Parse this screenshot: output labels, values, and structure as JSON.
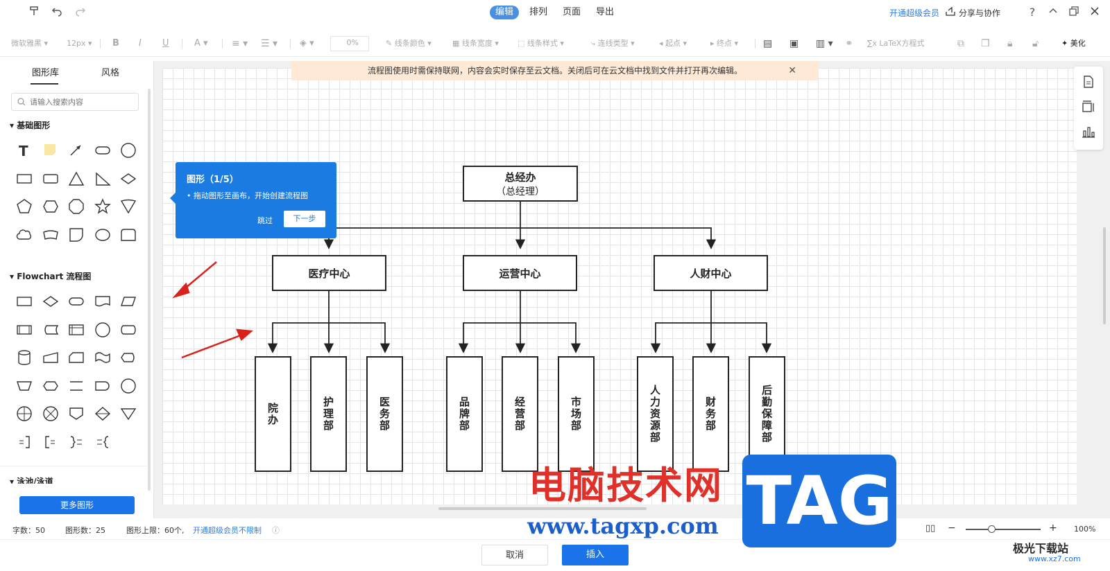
{
  "topbar": {
    "modes": [
      {
        "label": "编辑",
        "active": true
      },
      {
        "label": "排列",
        "active": false
      },
      {
        "label": "页面",
        "active": false
      },
      {
        "label": "导出",
        "active": false
      }
    ],
    "vip_link": "开通超级会员",
    "share_label": "分享与协作",
    "help": "?"
  },
  "toolbar": {
    "font": "微软雅黑",
    "size": "12px",
    "bold": "B",
    "italic": "I",
    "underline": "U",
    "font_color": "A",
    "opacity": "0%",
    "line_color": "线条颜色",
    "line_width": "线条宽度",
    "line_style": "线条样式",
    "connector_type": "连线类型",
    "start": "起点",
    "end": "终点",
    "latex": "LaTeX方程式",
    "beautify": "美化"
  },
  "left_panel": {
    "tabs": [
      {
        "label": "图形库",
        "active": true
      },
      {
        "label": "风格",
        "active": false
      }
    ],
    "search_placeholder": "请输入搜索内容",
    "basic_title": "基础图形",
    "flowchart_title": "Flowchart 流程图",
    "swimlane_title": "泳池/泳道",
    "more_button": "更多图形"
  },
  "notice": {
    "text": "流程图使用时需保持联网，内容会实时保存至云文档。关闭后可在云文档中找到文件并打开再次编辑。"
  },
  "tooltip": {
    "title": "图形（1/5）",
    "text": "• 拖动图形至画布，开始创建流程图",
    "skip": "跳过",
    "next": "下一步"
  },
  "diagram": {
    "root": {
      "title": "总经办",
      "subtitle": "（总经理）"
    },
    "centers": [
      "医疗中心",
      "运营中心",
      "人财中心"
    ],
    "departments": [
      "院办",
      "护理部",
      "医务部",
      "品牌部",
      "经营部",
      "市场部",
      "人力资源部",
      "财务部",
      "后勤保障部"
    ]
  },
  "status": {
    "chars": "字数：50",
    "shapes": "图形数：25",
    "limit": "图形上限：60个,",
    "vip": "开通超级会员不限制",
    "zoom": "100%"
  },
  "bottom": {
    "cancel": "取消",
    "insert": "插入"
  },
  "watermark": {
    "text": "电脑技术网",
    "url": "www.tagxp.com",
    "tag": "TAG",
    "site": "极光下载站",
    "site_url": "www.xz7.com"
  }
}
